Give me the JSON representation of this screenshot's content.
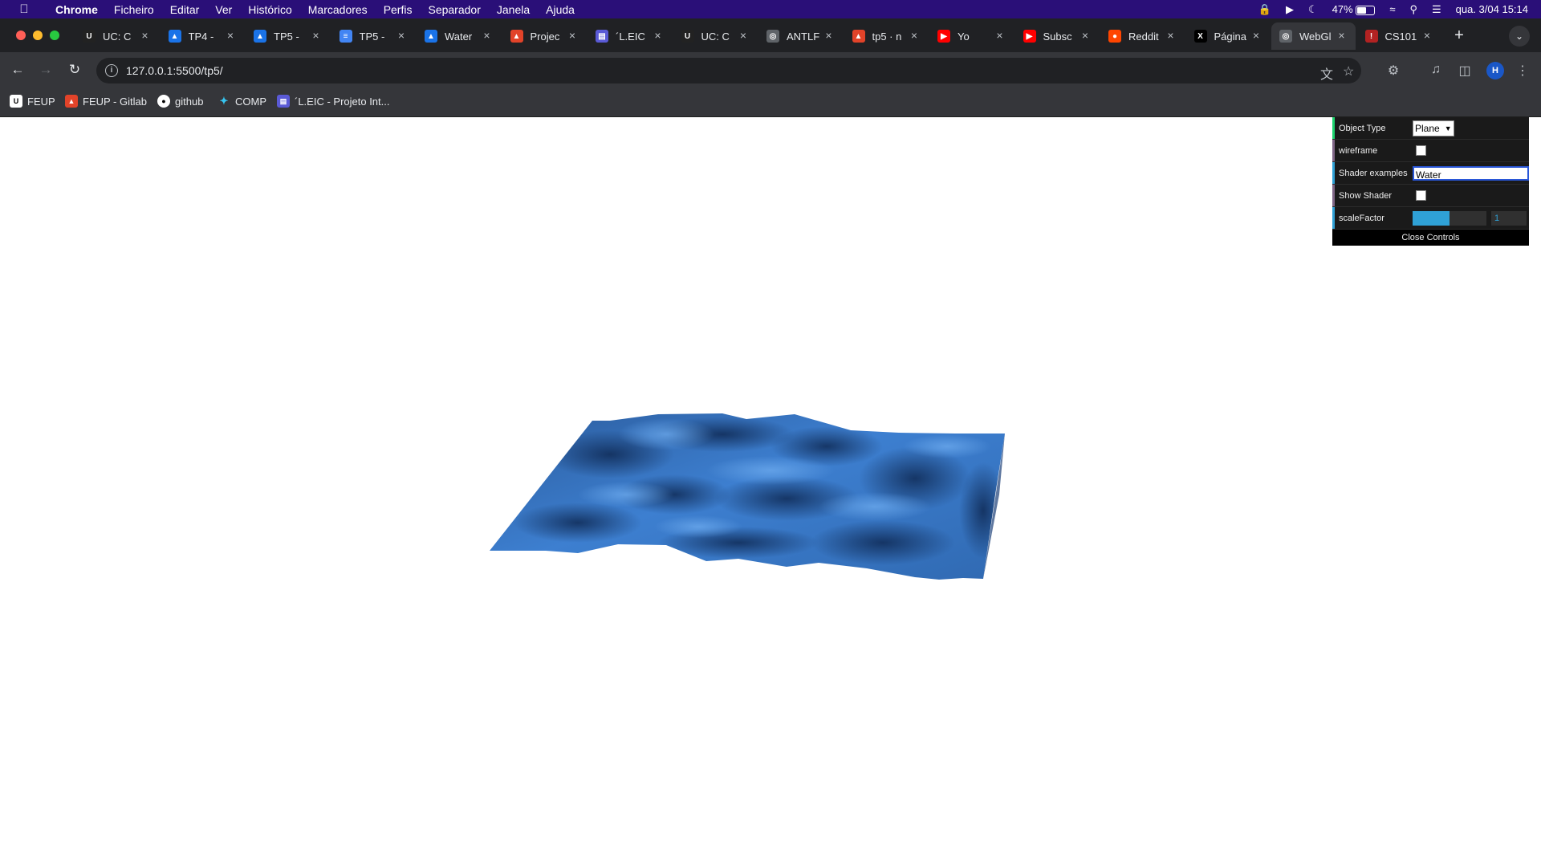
{
  "menubar": {
    "app": "Chrome",
    "items": [
      "Ficheiro",
      "Editar",
      "Ver",
      "Histórico",
      "Marcadores",
      "Perfis",
      "Separador",
      "Janela",
      "Ajuda"
    ],
    "battery": "47%",
    "battery_level": 0.47,
    "datetime": "qua. 3/04  15:14"
  },
  "tabs": [
    {
      "label": "UC: C",
      "favicon": "U",
      "color": "#222222"
    },
    {
      "label": "TP4 -",
      "favicon": "drive",
      "color": "#1a73e8"
    },
    {
      "label": "TP5 -",
      "favicon": "drive",
      "color": "#1a73e8"
    },
    {
      "label": "TP5 -",
      "favicon": "docs",
      "color": "#4285f4"
    },
    {
      "label": "Water",
      "favicon": "drive",
      "color": "#1a73e8"
    },
    {
      "label": "Projec",
      "favicon": "gitlab",
      "color": "#e24329"
    },
    {
      "label": "´L.EIC",
      "favicon": "form",
      "color": "#5a5ad6"
    },
    {
      "label": "UC: C",
      "favicon": "U",
      "color": "#222222"
    },
    {
      "label": "ANTLF",
      "favicon": "globe",
      "color": "#5f6368"
    },
    {
      "label": "tp5 · n",
      "favicon": "gitlab",
      "color": "#e24329"
    },
    {
      "label": "Yo",
      "favicon": "youtube",
      "color": "#ff0000"
    },
    {
      "label": "Subsc",
      "favicon": "youtube",
      "color": "#ff0000"
    },
    {
      "label": "Reddit",
      "favicon": "reddit",
      "color": "#ff4500"
    },
    {
      "label": "Página",
      "favicon": "x",
      "color": "#000000"
    },
    {
      "label": "WebGl",
      "favicon": "globe",
      "color": "#5f6368",
      "active": true
    },
    {
      "label": "CS101",
      "favicon": "cs",
      "color": "#b22222"
    }
  ],
  "address": {
    "url": "127.0.0.1:5500/tp5/"
  },
  "profile_initial": "H",
  "bookmarks": [
    {
      "label": "FEUP",
      "icon": "feup"
    },
    {
      "label": "FEUP - Gitlab",
      "icon": "gitlab"
    },
    {
      "label": "github",
      "icon": "github"
    },
    {
      "label": "COMP",
      "icon": "slack"
    },
    {
      "label": "´L.EIC - Projeto Int...",
      "icon": "form"
    }
  ],
  "gui": {
    "object_type_label": "Object Type",
    "object_type_value": "Plane",
    "wireframe_label": "wireframe",
    "shader_examples_label": "Shader examples",
    "shader_examples_value": "Water",
    "show_shader_label": "Show Shader",
    "scale_factor_label": "scaleFactor",
    "scale_factor_value": "1",
    "scale_factor_fraction": 0.5,
    "close_label": "Close Controls"
  },
  "colors": {
    "menubar": "#2a0f78",
    "water_light": "#3d7fd0",
    "water_dark": "#163a6e",
    "gui_bg": "#1a1a1a",
    "slider_fill": "#2fa1d6"
  }
}
